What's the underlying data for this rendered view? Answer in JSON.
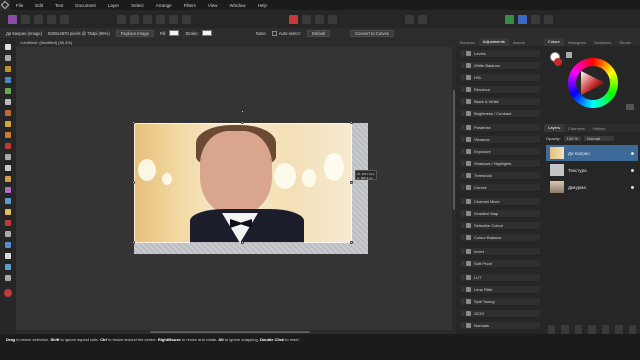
{
  "menubar": {
    "items": [
      "File",
      "Edit",
      "Text",
      "Document",
      "Layer",
      "Select",
      "Arrange",
      "Filters",
      "View",
      "Window",
      "Help"
    ]
  },
  "context": {
    "layer_name": "Ди Каприо (Image)",
    "dimensions": "5300x4870 pixels @ 75dpi (96%)",
    "replace_image": "Replace Image",
    "fill_label": "Fill:",
    "stroke_label": "Stroke:",
    "stroke_value": "None",
    "auto_select_label": "Auto-select:",
    "auto_select_value": "Default",
    "convert_to_curves": "Convert to Curves"
  },
  "document": {
    "tab_title": "<Untitled> (Modified) (55.4%)"
  },
  "tooltip": {
    "line1": "W: 1161.3 px",
    "line2": "H: 600.3 px"
  },
  "adjustments": {
    "tabs": [
      "Brushes",
      "Adjustments",
      "Assets"
    ],
    "active_tab": "Adjustments",
    "items": [
      "Levels",
      "White Balance",
      "HSL",
      "Recolour",
      "Black & White",
      "Brightness / Contrast",
      "Posterise",
      "Vibrance",
      "Exposure",
      "Shadows / Highlights",
      "Threshold",
      "Curves",
      "Channel Mixer",
      "Gradient Map",
      "Selective Colour",
      "Colour Balance",
      "Invert",
      "Soft Proof",
      "LUT",
      "Lens Filter",
      "Split Toning",
      "OCIO",
      "Normals"
    ]
  },
  "color_panel": {
    "tabs": [
      "Colour",
      "Histogram",
      "Swatches",
      "Stroke"
    ],
    "active_tab": "Colour"
  },
  "layers_panel": {
    "tabs": [
      "Layers",
      "Channels",
      "History"
    ],
    "active_tab": "Layers",
    "opacity_label": "Opacity:",
    "opacity_value": "100 %",
    "blend_mode": "Normal",
    "layers": [
      {
        "name": "Ди Каприо",
        "selected": true
      },
      {
        "name": "Текстура",
        "selected": false
      },
      {
        "name": "Дикурма",
        "selected": false
      }
    ]
  },
  "statusbar": {
    "segments": [
      {
        "bold": "Drag",
        "text": " to resize selection. "
      },
      {
        "bold": "Shift",
        "text": " to ignore aspect ratio. "
      },
      {
        "bold": "Ctrl",
        "text": " to resize around the centre. "
      },
      {
        "bold": "RightMouse",
        "text": " to resize and rotate. "
      },
      {
        "bold": "Alt",
        "text": " to ignore snapping. "
      },
      {
        "bold": "Double Click",
        "text": " to reset."
      }
    ]
  },
  "colors": {
    "selection_blue": "#3d6a99",
    "app_bg": "#1e1e1e",
    "panel_bg": "#262626",
    "canvas_bg": "#343434"
  }
}
